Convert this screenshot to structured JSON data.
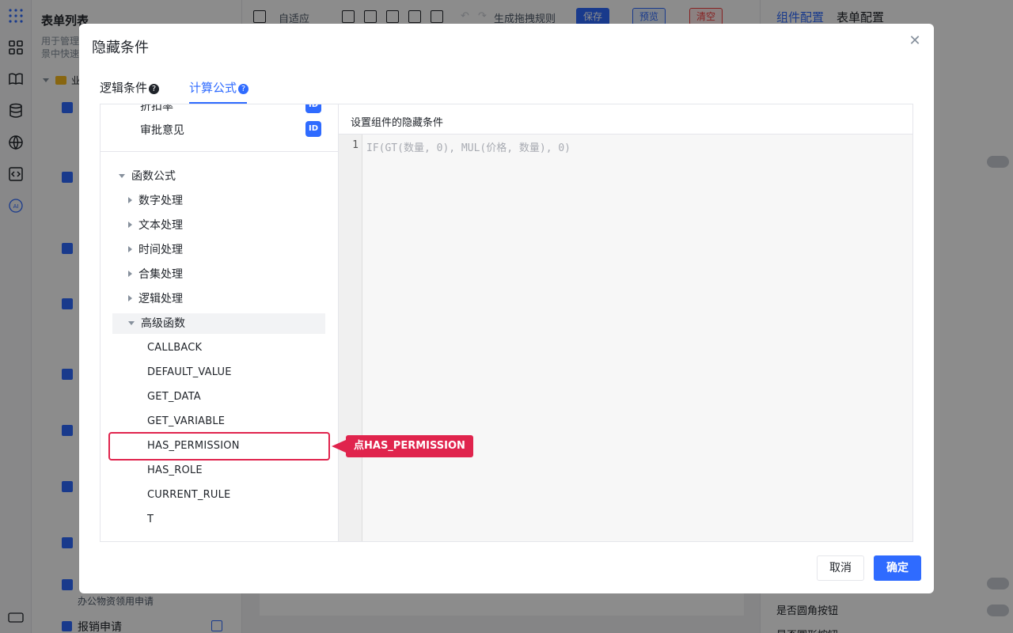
{
  "background": {
    "left_panel": {
      "title": "表单列表",
      "description": "用于管理\n景中快速",
      "tree_folder": "业",
      "item_desc": "办公物资领用申请",
      "item_label": "报销申请"
    },
    "toolbar": {
      "layout_label": "自适应",
      "generate_label": "生成拖拽规则",
      "save_label": "保存",
      "preview_label": "预览",
      "clear_label": "清空"
    },
    "right_panel": {
      "tab_component": "组件配置",
      "tab_form": "表单配置",
      "rounded_button_label": "是否圆角按钮",
      "round_button_label": "是否圆形按钮"
    }
  },
  "modal": {
    "title": "隐藏条件",
    "close_icon": "close-icon",
    "tabs": [
      {
        "label": "逻辑条件",
        "active": false
      },
      {
        "label": "计算公式",
        "active": true
      }
    ],
    "fields": [
      {
        "label": "折扣率",
        "badge": "ID"
      },
      {
        "label": "审批意见",
        "badge": "ID"
      }
    ],
    "function_tree": {
      "root_label": "函数公式",
      "categories": [
        {
          "label": "数字处理",
          "expanded": false
        },
        {
          "label": "文本处理",
          "expanded": false
        },
        {
          "label": "时间处理",
          "expanded": false
        },
        {
          "label": "合集处理",
          "expanded": false
        },
        {
          "label": "逻辑处理",
          "expanded": false
        },
        {
          "label": "高级函数",
          "expanded": true
        }
      ],
      "advanced_functions": [
        "CALLBACK",
        "DEFAULT_VALUE",
        "GET_DATA",
        "GET_VARIABLE",
        "HAS_PERMISSION",
        "HAS_ROLE",
        "CURRENT_RULE",
        "T"
      ]
    },
    "editor": {
      "header": "设置组件的隐藏条件",
      "line_number": "1",
      "placeholder": "IF(GT(数量, 0), MUL(价格, 数量), 0)"
    },
    "footer": {
      "cancel_label": "取消",
      "ok_label": "确定"
    }
  },
  "annotation": {
    "callout_text": "点HAS_PERMISSION",
    "color": "#e0244d"
  },
  "colors": {
    "accent": "#2f6bff",
    "mask": "rgba(0,0,0,0.45)"
  }
}
